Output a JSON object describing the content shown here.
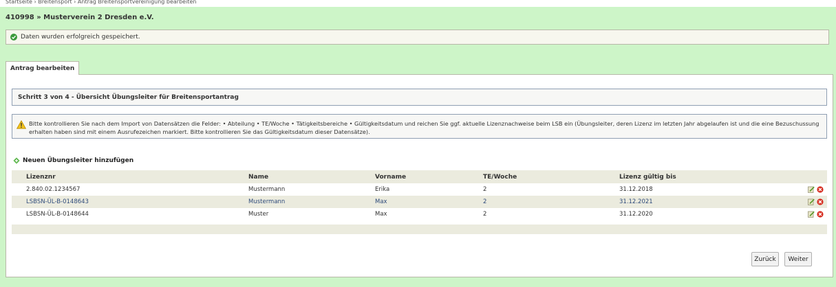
{
  "breadcrumb": "Startseite › Breitensport › Antrag Breitensportvereinigung bearbeiten",
  "page_title": "410998 » Musterverein 2 Dresden e.V.",
  "success_message": "Daten wurden erfolgreich gespeichert.",
  "tab_label": "Antrag bearbeiten",
  "step_title": "Schritt 3 von 4 - Übersicht Übungsleiter für Breitensportantrag",
  "warning_text": "Bitte kontrollieren Sie nach dem Import von Datensätzen die Felder: • Abteilung • TE/Woche • Tätigkeitsbereiche • Gültigkeitsdatum und reichen Sie ggf. aktuelle Lizenznachweise beim LSB ein (Übungsleiter, deren Lizenz im letzten Jahr abgelaufen ist und die eine Bezuschussung erhalten haben sind mit einem Ausrufezeichen markiert. Bitte kontrollieren Sie das Gültigkeitsdatum dieser Datensätze).",
  "add_label": "Neuen Übungsleiter hinzufügen",
  "table": {
    "headers": [
      "Lizenznr",
      "Name",
      "Vorname",
      "TE/Woche",
      "Lizenz gültig bis"
    ],
    "rows": [
      [
        "2.840.02.1234567",
        "Mustermann",
        "Erika",
        "2",
        "31.12.2018"
      ],
      [
        "LSBSN-ÜL-B-0148643",
        "Mustermann",
        "Max",
        "2",
        "31.12.2021"
      ],
      [
        "LSBSN-ÜL-B-0148644",
        "Muster",
        "Max",
        "2",
        "31.12.2020"
      ]
    ]
  },
  "buttons": {
    "back": "Zurück",
    "next": "Weiter"
  },
  "colors": {
    "background": "#cdf5c8",
    "panel": "#ffffff",
    "row_alt": "#ebebde",
    "link": "#2e4a7a"
  }
}
